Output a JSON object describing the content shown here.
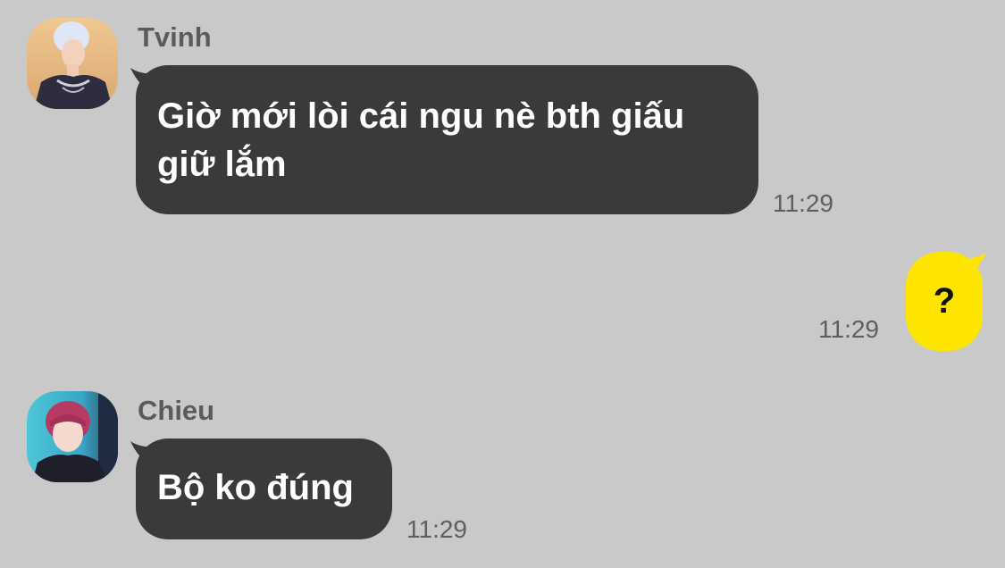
{
  "messages": [
    {
      "sender": "Tvinh",
      "avatar_icon": "profile-photo-tvinh",
      "text": "Giờ mới lòi cái ngu nè bth giấu giữ lắm",
      "time": "11:29",
      "direction": "incoming"
    },
    {
      "text": "?",
      "time": "11:29",
      "direction": "outgoing"
    },
    {
      "sender": "Chieu",
      "avatar_icon": "profile-photo-chieu",
      "text": "Bộ ko đúng",
      "time": "11:29",
      "direction": "incoming"
    }
  ],
  "colors": {
    "background": "#c9c9c9",
    "incoming_bubble": "#3a3a3c",
    "outgoing_bubble": "#fee500",
    "name_text": "#5b5b5b",
    "time_text": "#5f5f5f"
  }
}
